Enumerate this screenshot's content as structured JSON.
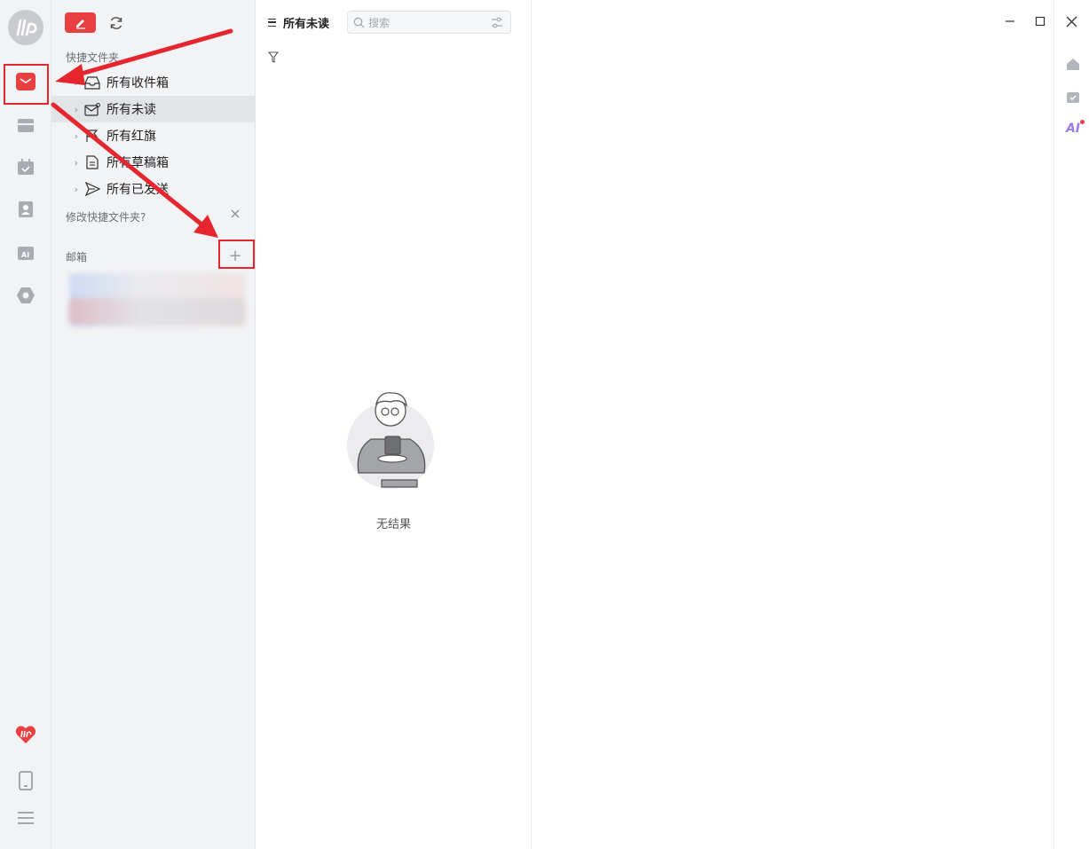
{
  "rail": {
    "items": [
      {
        "name": "mail-icon",
        "active": true
      },
      {
        "name": "folder-icon"
      },
      {
        "name": "calendar-icon"
      },
      {
        "name": "contacts-icon"
      },
      {
        "name": "ai-assistant-icon"
      },
      {
        "name": "apps-icon"
      },
      {
        "name": "brand-app-icon"
      },
      {
        "name": "phone-icon"
      },
      {
        "name": "menu-icon"
      }
    ]
  },
  "folders": {
    "quick_title": "快捷文件夹",
    "items": [
      {
        "label": "所有收件箱",
        "icon": "inbox-icon"
      },
      {
        "label": "所有未读",
        "icon": "unread-mail-icon"
      },
      {
        "label": "所有红旗",
        "icon": "flag-icon"
      },
      {
        "label": "所有草稿箱",
        "icon": "draft-icon"
      },
      {
        "label": "所有已发送",
        "icon": "sent-icon"
      }
    ],
    "edit_quick": "修改快捷文件夹?",
    "mailbox_title": "邮箱",
    "add_symbol": "+"
  },
  "list": {
    "title": "所有未读",
    "search_placeholder": "搜索",
    "empty_text": "无结果"
  },
  "colors": {
    "accent": "#e84040",
    "annotation": "#e5262e",
    "ai": "#9b7be8"
  }
}
